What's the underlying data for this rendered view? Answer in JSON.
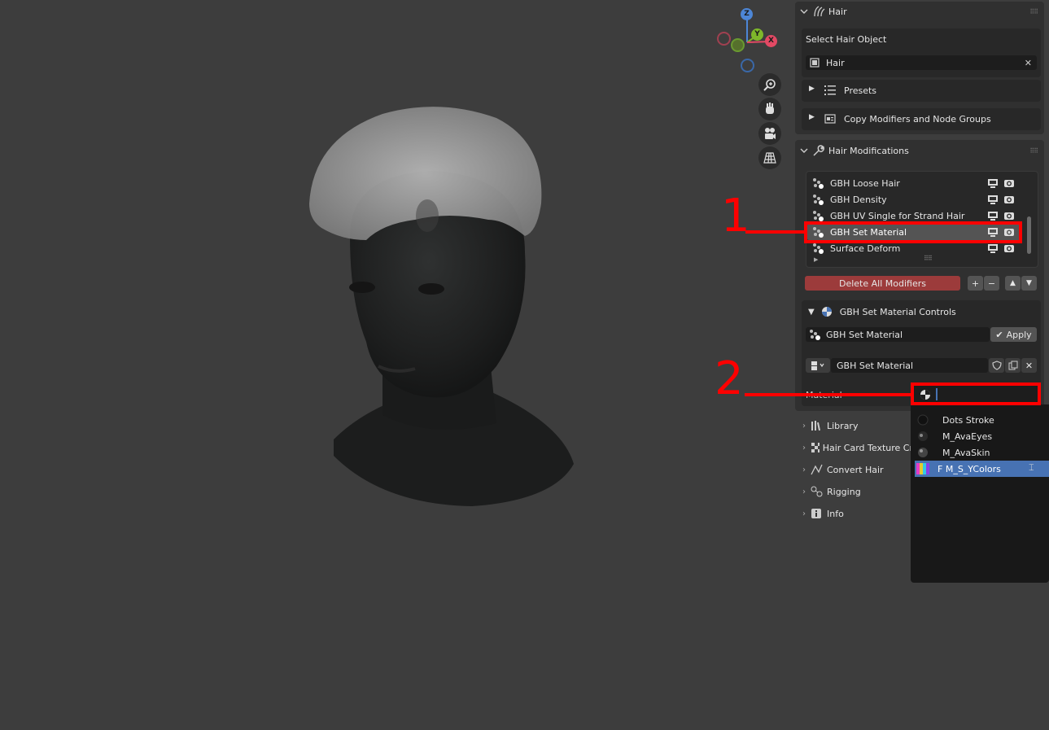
{
  "gizmo": {
    "z": "Z",
    "y": "Y",
    "x": "X"
  },
  "hair_panel": {
    "title": "Hair",
    "select_label": "Select Hair Object",
    "object_value": "Hair",
    "presets_label": "Presets",
    "copy_label": "Copy Modifiers and Node Groups"
  },
  "hair_mods": {
    "title": "Hair Modifications",
    "items": [
      {
        "label": "GBH Loose Hair"
      },
      {
        "label": "GBH Density"
      },
      {
        "label": "GBH UV Single for Strand Hair"
      },
      {
        "label": "GBH Set Material"
      },
      {
        "label": "Surface Deform"
      }
    ],
    "delete_all_label": "Delete All Modifiers",
    "controls_title": "GBH Set Material Controls",
    "modifier_field": "GBH Set Material",
    "apply_label": "Apply",
    "nodegroup_field": "GBH Set Material",
    "material_label": "Material"
  },
  "collapsed_panels": [
    {
      "label": "Library"
    },
    {
      "label": "Hair Card Texture Cr"
    },
    {
      "label": "Convert Hair"
    },
    {
      "label": "Rigging"
    },
    {
      "label": "Info"
    }
  ],
  "dropdown": {
    "items": [
      {
        "label": "Dots Stroke"
      },
      {
        "label": "M_AvaEyes"
      },
      {
        "label": "M_AvaSkin"
      },
      {
        "label": "F M_S_YColors"
      }
    ]
  },
  "annotations": {
    "one": "1",
    "two": "2"
  },
  "colors": {
    "callout": "#ff0000",
    "highlight": "#4772b3",
    "delete_button": "#9c3b3b"
  }
}
